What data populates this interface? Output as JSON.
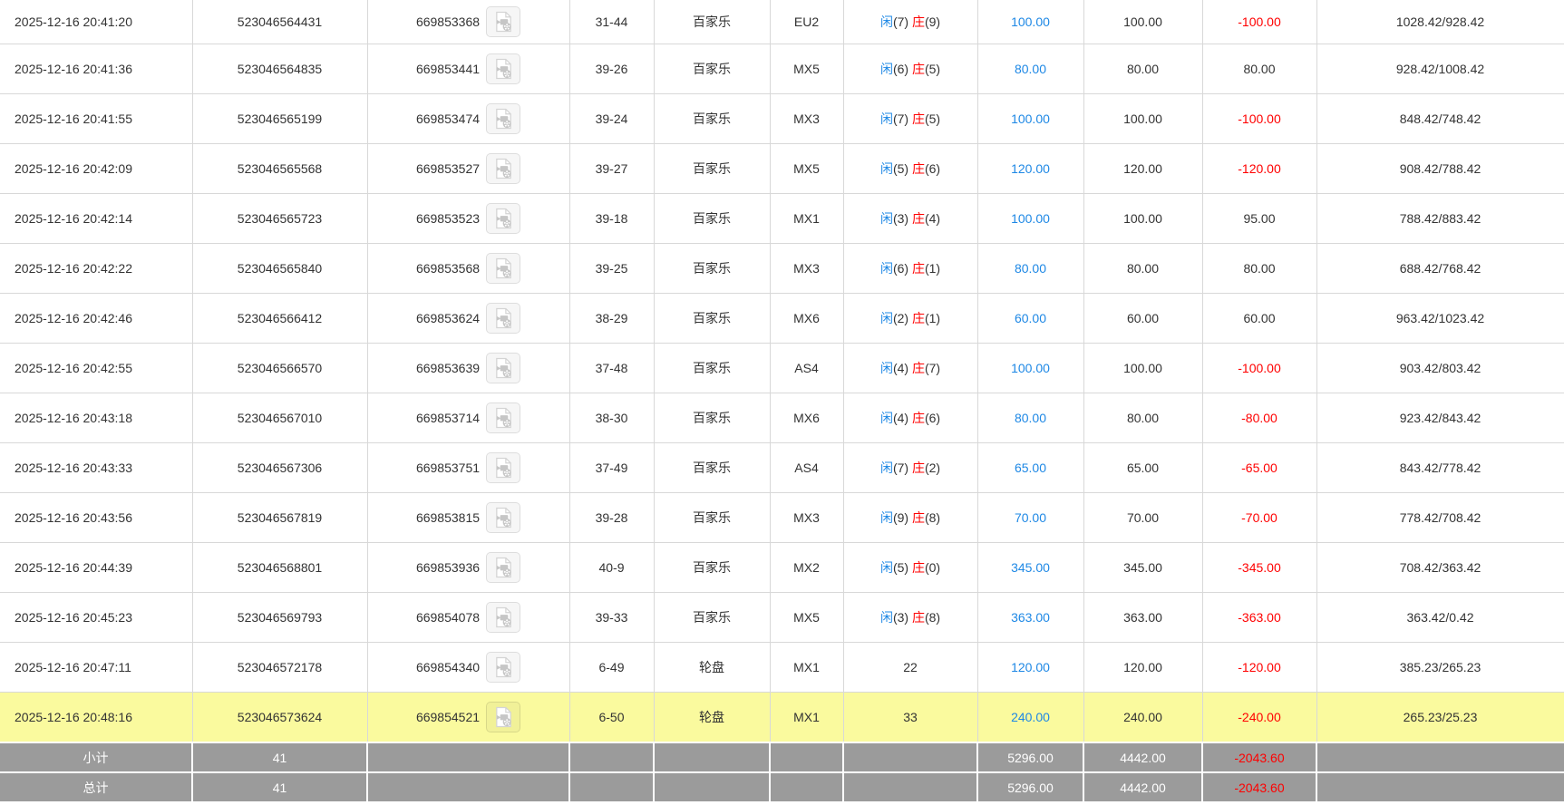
{
  "table": {
    "labels": {
      "player": "闲",
      "banker": "庄"
    },
    "colors": {
      "link_blue": "#1E88E5",
      "negative_red": "#FF0000",
      "highlight_yellow": "#FAFA9E",
      "summary_gray": "#9B9B9B",
      "border_gray": "#D8D8D8"
    },
    "rows": [
      {
        "time": "2025-12-16 20:41:20",
        "bet_id": "523046564431",
        "game_id": "669853368",
        "round": "31-44",
        "game_type": "百家乐",
        "table_code": "EU2",
        "result": {
          "player": "7",
          "banker": "9"
        },
        "valid_bet": "100.00",
        "bet_amount": "100.00",
        "win_loss": "-100.00",
        "balance": "1028.42/928.42",
        "highlighted": false
      },
      {
        "time": "2025-12-16 20:41:36",
        "bet_id": "523046564835",
        "game_id": "669853441",
        "round": "39-26",
        "game_type": "百家乐",
        "table_code": "MX5",
        "result": {
          "player": "6",
          "banker": "5"
        },
        "valid_bet": "80.00",
        "bet_amount": "80.00",
        "win_loss": "80.00",
        "balance": "928.42/1008.42",
        "highlighted": false
      },
      {
        "time": "2025-12-16 20:41:55",
        "bet_id": "523046565199",
        "game_id": "669853474",
        "round": "39-24",
        "game_type": "百家乐",
        "table_code": "MX3",
        "result": {
          "player": "7",
          "banker": "5"
        },
        "valid_bet": "100.00",
        "bet_amount": "100.00",
        "win_loss": "-100.00",
        "balance": "848.42/748.42",
        "highlighted": false
      },
      {
        "time": "2025-12-16 20:42:09",
        "bet_id": "523046565568",
        "game_id": "669853527",
        "round": "39-27",
        "game_type": "百家乐",
        "table_code": "MX5",
        "result": {
          "player": "5",
          "banker": "6"
        },
        "valid_bet": "120.00",
        "bet_amount": "120.00",
        "win_loss": "-120.00",
        "balance": "908.42/788.42",
        "highlighted": false
      },
      {
        "time": "2025-12-16 20:42:14",
        "bet_id": "523046565723",
        "game_id": "669853523",
        "round": "39-18",
        "game_type": "百家乐",
        "table_code": "MX1",
        "result": {
          "player": "3",
          "banker": "4"
        },
        "valid_bet": "100.00",
        "bet_amount": "100.00",
        "win_loss": "95.00",
        "balance": "788.42/883.42",
        "highlighted": false
      },
      {
        "time": "2025-12-16 20:42:22",
        "bet_id": "523046565840",
        "game_id": "669853568",
        "round": "39-25",
        "game_type": "百家乐",
        "table_code": "MX3",
        "result": {
          "player": "6",
          "banker": "1"
        },
        "valid_bet": "80.00",
        "bet_amount": "80.00",
        "win_loss": "80.00",
        "balance": "688.42/768.42",
        "highlighted": false
      },
      {
        "time": "2025-12-16 20:42:46",
        "bet_id": "523046566412",
        "game_id": "669853624",
        "round": "38-29",
        "game_type": "百家乐",
        "table_code": "MX6",
        "result": {
          "player": "2",
          "banker": "1"
        },
        "valid_bet": "60.00",
        "bet_amount": "60.00",
        "win_loss": "60.00",
        "balance": "963.42/1023.42",
        "highlighted": false
      },
      {
        "time": "2025-12-16 20:42:55",
        "bet_id": "523046566570",
        "game_id": "669853639",
        "round": "37-48",
        "game_type": "百家乐",
        "table_code": "AS4",
        "result": {
          "player": "4",
          "banker": "7"
        },
        "valid_bet": "100.00",
        "bet_amount": "100.00",
        "win_loss": "-100.00",
        "balance": "903.42/803.42",
        "highlighted": false
      },
      {
        "time": "2025-12-16 20:43:18",
        "bet_id": "523046567010",
        "game_id": "669853714",
        "round": "38-30",
        "game_type": "百家乐",
        "table_code": "MX6",
        "result": {
          "player": "4",
          "banker": "6"
        },
        "valid_bet": "80.00",
        "bet_amount": "80.00",
        "win_loss": "-80.00",
        "balance": "923.42/843.42",
        "highlighted": false
      },
      {
        "time": "2025-12-16 20:43:33",
        "bet_id": "523046567306",
        "game_id": "669853751",
        "round": "37-49",
        "game_type": "百家乐",
        "table_code": "AS4",
        "result": {
          "player": "7",
          "banker": "2"
        },
        "valid_bet": "65.00",
        "bet_amount": "65.00",
        "win_loss": "-65.00",
        "balance": "843.42/778.42",
        "highlighted": false
      },
      {
        "time": "2025-12-16 20:43:56",
        "bet_id": "523046567819",
        "game_id": "669853815",
        "round": "39-28",
        "game_type": "百家乐",
        "table_code": "MX3",
        "result": {
          "player": "9",
          "banker": "8"
        },
        "valid_bet": "70.00",
        "bet_amount": "70.00",
        "win_loss": "-70.00",
        "balance": "778.42/708.42",
        "highlighted": false
      },
      {
        "time": "2025-12-16 20:44:39",
        "bet_id": "523046568801",
        "game_id": "669853936",
        "round": "40-9",
        "game_type": "百家乐",
        "table_code": "MX2",
        "result": {
          "player": "5",
          "banker": "0"
        },
        "valid_bet": "345.00",
        "bet_amount": "345.00",
        "win_loss": "-345.00",
        "balance": "708.42/363.42",
        "highlighted": false
      },
      {
        "time": "2025-12-16 20:45:23",
        "bet_id": "523046569793",
        "game_id": "669854078",
        "round": "39-33",
        "game_type": "百家乐",
        "table_code": "MX5",
        "result": {
          "player": "3",
          "banker": "8"
        },
        "valid_bet": "363.00",
        "bet_amount": "363.00",
        "win_loss": "-363.00",
        "balance": "363.42/0.42",
        "highlighted": false
      },
      {
        "time": "2025-12-16 20:47:11",
        "bet_id": "523046572178",
        "game_id": "669854340",
        "round": "6-49",
        "game_type": "轮盘",
        "table_code": "MX1",
        "result": {
          "number": "22"
        },
        "valid_bet": "120.00",
        "bet_amount": "120.00",
        "win_loss": "-120.00",
        "balance": "385.23/265.23",
        "highlighted": false
      },
      {
        "time": "2025-12-16 20:48:16",
        "bet_id": "523046573624",
        "game_id": "669854521",
        "round": "6-50",
        "game_type": "轮盘",
        "table_code": "MX1",
        "result": {
          "number": "33"
        },
        "valid_bet": "240.00",
        "bet_amount": "240.00",
        "win_loss": "-240.00",
        "balance": "265.23/25.23",
        "highlighted": true
      }
    ],
    "summary_rows": [
      {
        "label": "小计",
        "count": "41",
        "valid_bet": "5296.00",
        "bet_amount": "4442.00",
        "win_loss": "-2043.60"
      },
      {
        "label": "总计",
        "count": "41",
        "valid_bet": "5296.00",
        "bet_amount": "4442.00",
        "win_loss": "-2043.60"
      }
    ]
  }
}
